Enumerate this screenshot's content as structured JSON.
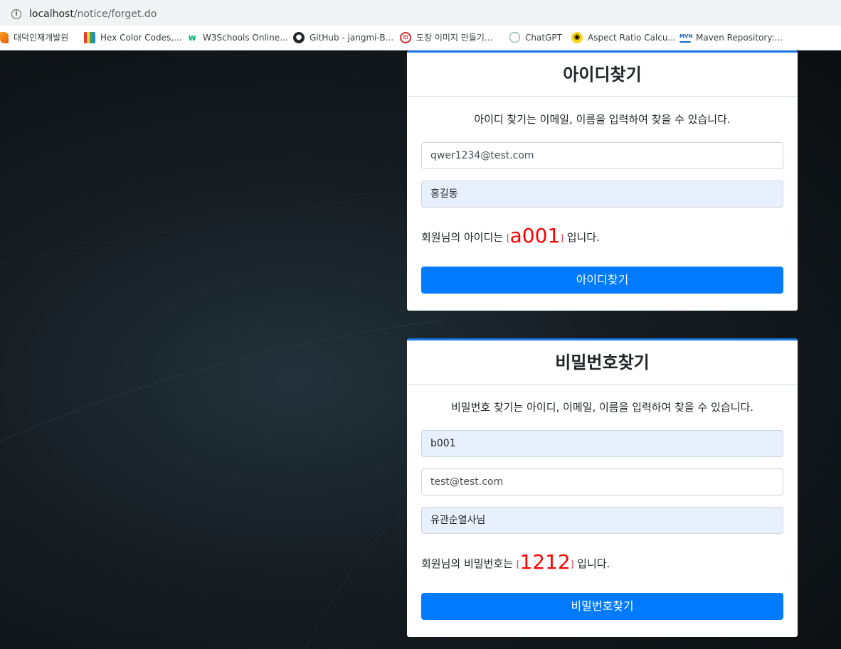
{
  "browser": {
    "url_host": "localhost",
    "url_path": "/notice/forget.do",
    "bookmarks": [
      {
        "label": "대덕인재개발원",
        "icon": "paintbrush-icon"
      },
      {
        "label": "Hex Color Codes,...",
        "icon": "color-book-icon"
      },
      {
        "label": "W3Schools Online...",
        "icon": "w3schools-icon"
      },
      {
        "label": "GitHub - jangmi-B...",
        "icon": "github-icon"
      },
      {
        "label": "도장 이미지 만들기...",
        "icon": "stamp-icon"
      },
      {
        "label": "ChatGPT",
        "icon": "chatgpt-icon"
      },
      {
        "label": "Aspect Ratio Calcu...",
        "icon": "aspect-ratio-icon"
      },
      {
        "label": "Maven Repository:...",
        "icon": "maven-icon"
      }
    ]
  },
  "find_id": {
    "title": "아이디찾기",
    "description": "아이디 찾기는 이메일, 이름을 입력하여 찾을 수 있습니다.",
    "email_value": "qwer1234@test.com",
    "name_value": "홍길동",
    "result_prefix": "회원님의 아이디는 ",
    "bracket_open": "[",
    "result_value": "a001",
    "bracket_close": "]",
    "result_suffix": " 입니다.",
    "button_label": "아이디찾기"
  },
  "find_pw": {
    "title": "비밀번호찾기",
    "description": "비밀번호 찾기는 아이디, 이메일, 이름을 입력하여 찾을 수 있습니다.",
    "id_value": "b001",
    "email_value": "test@test.com",
    "name_value": "유관순열사님",
    "result_prefix": "회원님의 비밀번호는 ",
    "bracket_open": "[",
    "result_value": "1212",
    "bracket_close": "]",
    "result_suffix": " 입니다.",
    "button_label": "비밀번호찾기"
  },
  "colors": {
    "accent": "#007bff",
    "result_highlight": "#ff0000",
    "card_top_border": "#1a7ae8"
  }
}
